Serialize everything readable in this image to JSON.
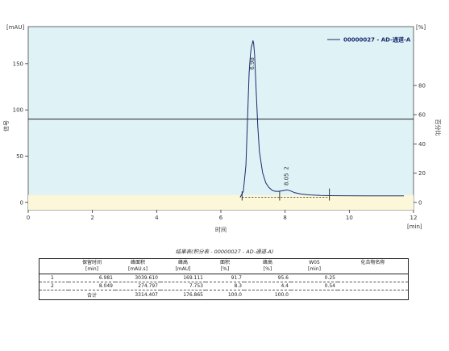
{
  "chart_data": {
    "type": "line",
    "legend": "00000027 - AD-通道-A",
    "xlabel": "时间",
    "xunit": "[min]",
    "ylabel_left": "信号",
    "yunit_left": "[mAU]",
    "ylabel_right": "百分比",
    "yunit_right": "[%]",
    "xlim": [
      0,
      12
    ],
    "ylim": [
      -8,
      190
    ],
    "ylim_right": [
      -5.06,
      120.2
    ],
    "xticks": [
      0,
      2,
      4,
      6,
      8,
      10,
      12
    ],
    "yticks_left": [
      0,
      50,
      100,
      150
    ],
    "yticks_right": [
      0,
      20,
      40,
      60,
      80
    ],
    "legend_position": "top-right",
    "plot_background": "#dff3f7",
    "trace_color": "#1a2a6c",
    "horizontal_line_y": 90,
    "baseline_band_y": 8,
    "x": [
      6.6,
      6.7,
      6.78,
      6.84,
      6.88,
      6.92,
      6.95,
      6.98,
      7.0,
      7.02,
      7.05,
      7.1,
      7.15,
      7.2,
      7.3,
      7.4,
      7.5,
      7.6,
      7.7,
      7.8,
      7.9,
      8.0,
      8.05,
      8.1,
      8.2,
      8.3,
      8.5,
      8.8,
      9.1,
      9.4,
      9.8,
      10.5,
      11.2,
      11.7
    ],
    "y": [
      5.5,
      12,
      40,
      100,
      140,
      160,
      168,
      172,
      175,
      172,
      160,
      120,
      82,
      55,
      32,
      21,
      16,
      13,
      12,
      12,
      12.5,
      13,
      13.5,
      13.2,
      12,
      10.5,
      9,
      8,
      7.5,
      7.3,
      7.2,
      7.1,
      7,
      7
    ],
    "peaks": [
      {
        "label": "6.98",
        "x": 6.98,
        "y": 175
      },
      {
        "label": "8.05",
        "x": 8.05,
        "y": 13.5,
        "id": "2"
      }
    ],
    "markers_x": [
      6.66,
      7.83,
      9.38
    ]
  },
  "table": {
    "title": "结果表(积分表 - 00000027 - AD-通道-A)",
    "headers": [
      {
        "l1": "",
        "l2": ""
      },
      {
        "l1": "保留时间",
        "l2": "[min]"
      },
      {
        "l1": "峰面积",
        "l2": "[mAU.s]"
      },
      {
        "l1": "峰高",
        "l2": "[mAU]"
      },
      {
        "l1": "面积",
        "l2": "[%]"
      },
      {
        "l1": "峰高",
        "l2": "[%]"
      },
      {
        "l1": "W05",
        "l2": "[min]"
      },
      {
        "l1": "化合物名称",
        "l2": ""
      }
    ],
    "rows": [
      [
        "1",
        "6.981",
        "3039.610",
        "169.111",
        "91.7",
        "95.6",
        "0.25",
        ""
      ],
      [
        "2",
        "8.049",
        "274.797",
        "7.753",
        "8.3",
        "4.4",
        "0.54",
        ""
      ]
    ],
    "total": [
      "",
      "合计",
      "3314.407",
      "176.865",
      "100.0",
      "100.0",
      "",
      ""
    ]
  }
}
